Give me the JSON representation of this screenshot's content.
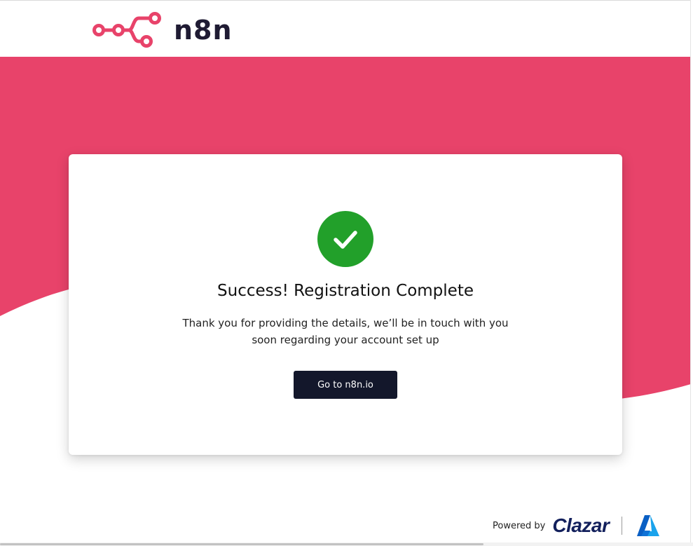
{
  "brand": {
    "name": "n8n",
    "accent_color": "#e8436a"
  },
  "card": {
    "title": "Success! Registration Complete",
    "message": "Thank you for providing the details, we’ll be in touch with you soon regarding your account set up",
    "button_label": "Go to n8n.io",
    "success_color": "#22a02a",
    "icon": "check-icon"
  },
  "footer": {
    "powered_by": "Powered by",
    "partner_name": "Clazar",
    "partner_icon": "azure-icon"
  }
}
